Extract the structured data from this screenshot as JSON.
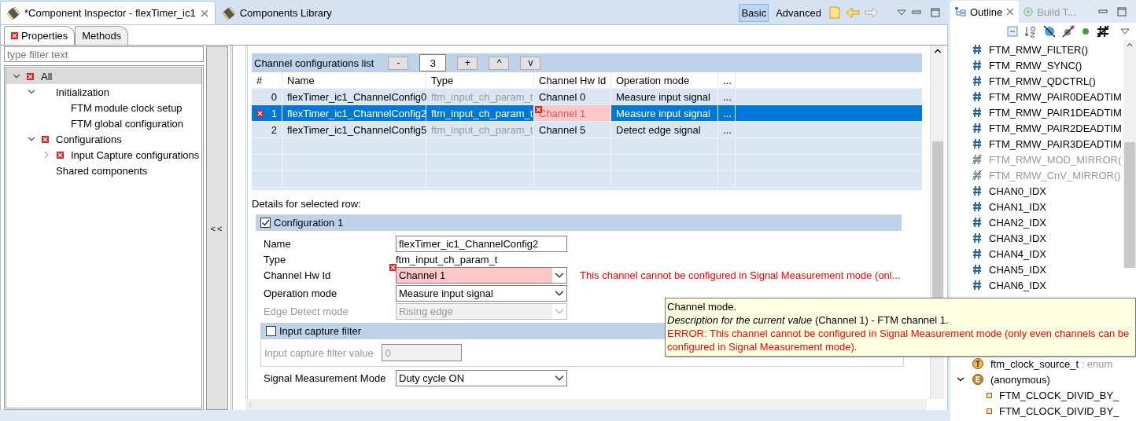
{
  "editor_tabs": [
    {
      "label": "*Component Inspector - flexTimer_ic1",
      "selected": true,
      "closable": true
    },
    {
      "label": "Components Library",
      "selected": false
    }
  ],
  "view_modes": [
    {
      "label": "Basic",
      "selected": true
    },
    {
      "label": "Advanced",
      "selected": false
    }
  ],
  "inspector_tabs": [
    {
      "label": "Properties",
      "selected": true,
      "error": true
    },
    {
      "label": "Methods",
      "selected": false,
      "error": false
    }
  ],
  "filter": {
    "placeholder": "type filter text"
  },
  "tree": [
    {
      "label": "All",
      "error": true,
      "expanded": true,
      "selected": true,
      "children": [
        {
          "label": "Initialization",
          "expanded": true,
          "selected": false,
          "children": [
            {
              "label": "FTM module clock setup",
              "selected": false
            },
            {
              "label": "FTM global configuration",
              "selected": false
            }
          ]
        },
        {
          "label": "Configurations",
          "error": true,
          "expanded": true,
          "selected": false,
          "children": [
            {
              "label": "Input Capture configurations",
              "error": true,
              "expanded": false,
              "selected": false
            }
          ]
        },
        {
          "label": "Shared components",
          "selected": false
        }
      ]
    }
  ],
  "collapse_button": "<<",
  "channel_list": {
    "title": "Channel configurations list",
    "count": "3",
    "buttons": [
      "-",
      "+",
      "^",
      "v"
    ],
    "columns": [
      "#",
      "Name",
      "Type",
      "Channel Hw Id",
      "Operation mode",
      "..."
    ],
    "rows": [
      {
        "index": "0",
        "name": "flexTimer_ic1_ChannelConfig0",
        "type": "ftm_input_ch_param_t",
        "hw_id": "Channel 0",
        "mode": "Measure input signal",
        "more": "...",
        "selected": false,
        "error": false,
        "hw_id_invalid": false
      },
      {
        "index": "1",
        "name": "flexTimer_ic1_ChannelConfig2",
        "type": "ftm_input_ch_param_t",
        "hw_id": "Channel 1",
        "mode": "Measure input signal",
        "more": "...",
        "selected": true,
        "error": true,
        "hw_id_invalid": true
      },
      {
        "index": "2",
        "name": "flexTimer_ic1_ChannelConfig5",
        "type": "ftm_input_ch_param_t",
        "hw_id": "Channel 5",
        "mode": "Detect edge signal",
        "more": "...",
        "selected": false,
        "error": false,
        "hw_id_invalid": false
      }
    ]
  },
  "details": {
    "label": "Details for selected row:",
    "group": {
      "title": "Configuration 1",
      "checked": true
    },
    "fields": [
      {
        "kind": "input",
        "label": "Name",
        "value": "flexTimer_ic1_ChannelConfig2"
      },
      {
        "kind": "text",
        "label": "Type",
        "value": "ftm_input_ch_param_t"
      },
      {
        "kind": "select",
        "label": "Channel Hw Id",
        "value": "Channel 1",
        "error": true,
        "message": "This channel cannot be configured in Signal Measurement mode (onl..."
      },
      {
        "kind": "select",
        "label": "Operation mode",
        "value": "Measure input signal"
      },
      {
        "kind": "select",
        "label": "Edge Detect mode",
        "value": "Rising edge",
        "disabled": true
      }
    ],
    "filter_group": {
      "title": "Input capture filter",
      "checked": false,
      "fields": [
        {
          "kind": "input",
          "label": "Input capture filter value",
          "value": "0",
          "disabled": true
        }
      ]
    },
    "after_fields": [
      {
        "kind": "select",
        "label": "Signal Measurement Mode",
        "value": "Duty cycle ON"
      }
    ]
  },
  "tooltip": {
    "title": "Channel mode.",
    "description": "*Description for the current value* (Channel 1) - FTM channel 1.",
    "error": "ERROR: This channel cannot be configured in Signal Measurement mode (only even channels can be configured in Signal Measurement mode)."
  },
  "outline": {
    "tabs": [
      {
        "label": "Outline",
        "selected": true
      },
      {
        "label": "Build T...",
        "selected": false
      }
    ],
    "items": [
      {
        "kind": "macro",
        "label": "FTM_RMW_FILTER()"
      },
      {
        "kind": "macro",
        "label": "FTM_RMW_SYNC()"
      },
      {
        "kind": "macro",
        "label": "FTM_RMW_QDCTRL()"
      },
      {
        "kind": "macro",
        "label": "FTM_RMW_PAIR0DEADTIM"
      },
      {
        "kind": "macro",
        "label": "FTM_RMW_PAIR1DEADTIM"
      },
      {
        "kind": "macro",
        "label": "FTM_RMW_PAIR2DEADTIM"
      },
      {
        "kind": "macro",
        "label": "FTM_RMW_PAIR3DEADTIM"
      },
      {
        "kind": "macro-inactive",
        "label": "FTM_RMW_MOD_MIRROR("
      },
      {
        "kind": "macro-inactive",
        "label": "FTM_RMW_CnV_MIRROR()"
      },
      {
        "kind": "macro",
        "label": "CHAN0_IDX"
      },
      {
        "kind": "macro",
        "label": "CHAN1_IDX"
      },
      {
        "kind": "macro",
        "label": "CHAN2_IDX"
      },
      {
        "kind": "macro",
        "label": "CHAN3_IDX"
      },
      {
        "kind": "macro",
        "label": "CHAN4_IDX"
      },
      {
        "kind": "macro",
        "label": "CHAN5_IDX"
      },
      {
        "kind": "macro",
        "label": "CHAN6_IDX"
      }
    ],
    "items_below": [
      {
        "kind": "typedef",
        "label": "ftm_clock_source_t",
        "detail": ": enum"
      },
      {
        "kind": "enum",
        "label": "(anonymous)",
        "expanded": true,
        "children": [
          {
            "kind": "enumerator",
            "label": "FTM_CLOCK_DIVID_BY_"
          },
          {
            "kind": "enumerator",
            "label": "FTM_CLOCK_DIVID_BY_"
          }
        ]
      }
    ]
  }
}
